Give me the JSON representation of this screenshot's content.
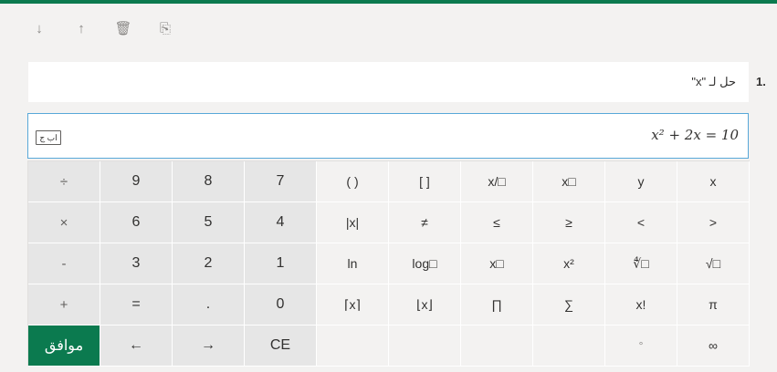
{
  "toolbar": {
    "items": [
      {
        "name": "move-down-icon",
        "glyph": "↓"
      },
      {
        "name": "move-up-icon",
        "glyph": "↑"
      },
      {
        "name": "delete-icon",
        "glyph": "🗑"
      },
      {
        "name": "copy-icon",
        "glyph": "⎘"
      }
    ]
  },
  "question": {
    "number": ".1",
    "text": "حل لـ \"x\""
  },
  "answer": {
    "lang_toggle": "اب ج",
    "expression": "x² + 2x = 10"
  },
  "keyboard": {
    "rows": [
      [
        "÷",
        "9",
        "8",
        "7",
        "( )",
        "[ ]",
        "x/□",
        "x□",
        "y",
        "x"
      ],
      [
        "×",
        "6",
        "5",
        "4",
        "|x|",
        "≠",
        "≤",
        "≥",
        "<",
        ">"
      ],
      [
        "-",
        "3",
        "2",
        "1",
        "ln",
        "log□",
        "x□",
        "x²",
        "∜□",
        "√□"
      ],
      [
        "+",
        "=",
        ".",
        "0",
        "⌈x⌉",
        "⌊x⌋",
        "∏",
        "∑",
        "x!",
        "π"
      ],
      [
        "موافق",
        "←",
        "→",
        "CE",
        "",
        "",
        "",
        "",
        "°",
        "∞"
      ]
    ]
  },
  "colors": {
    "accent": "#0b7a4f"
  }
}
